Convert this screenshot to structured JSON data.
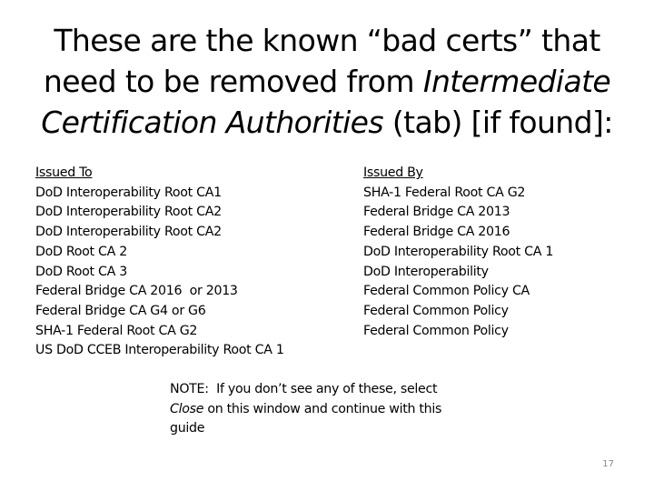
{
  "title": {
    "part1": "These are the known “bad certs” that need to be removed from ",
    "italic1": "Intermediate Certification Authorities",
    "part2": " (tab) [if found]:"
  },
  "issued_to": {
    "header": "Issued To",
    "items": [
      "DoD Interoperability Root CA1",
      "DoD Interoperability Root CA2",
      "DoD Interoperability Root CA2",
      "DoD Root CA 2",
      "DoD Root CA 3",
      "Federal Bridge CA 2016  or 2013",
      "Federal Bridge CA G4 or G6",
      "SHA-1 Federal Root CA G2",
      "US DoD CCEB Interoperability Root CA 1"
    ]
  },
  "issued_by": {
    "header": "Issued By",
    "items": [
      "SHA-1 Federal Root CA G2",
      "Federal Bridge CA 2013",
      "Federal Bridge CA 2016",
      "DoD Interoperability Root CA 1",
      "DoD Interoperability",
      "Federal Common Policy CA",
      "Federal Common Policy",
      "Federal Common Policy"
    ]
  },
  "note": {
    "prefix": "NOTE:  If you don’t see any of these, select ",
    "italic": "Close",
    "suffix": " on this window and continue with this guide"
  },
  "page_number": "17"
}
